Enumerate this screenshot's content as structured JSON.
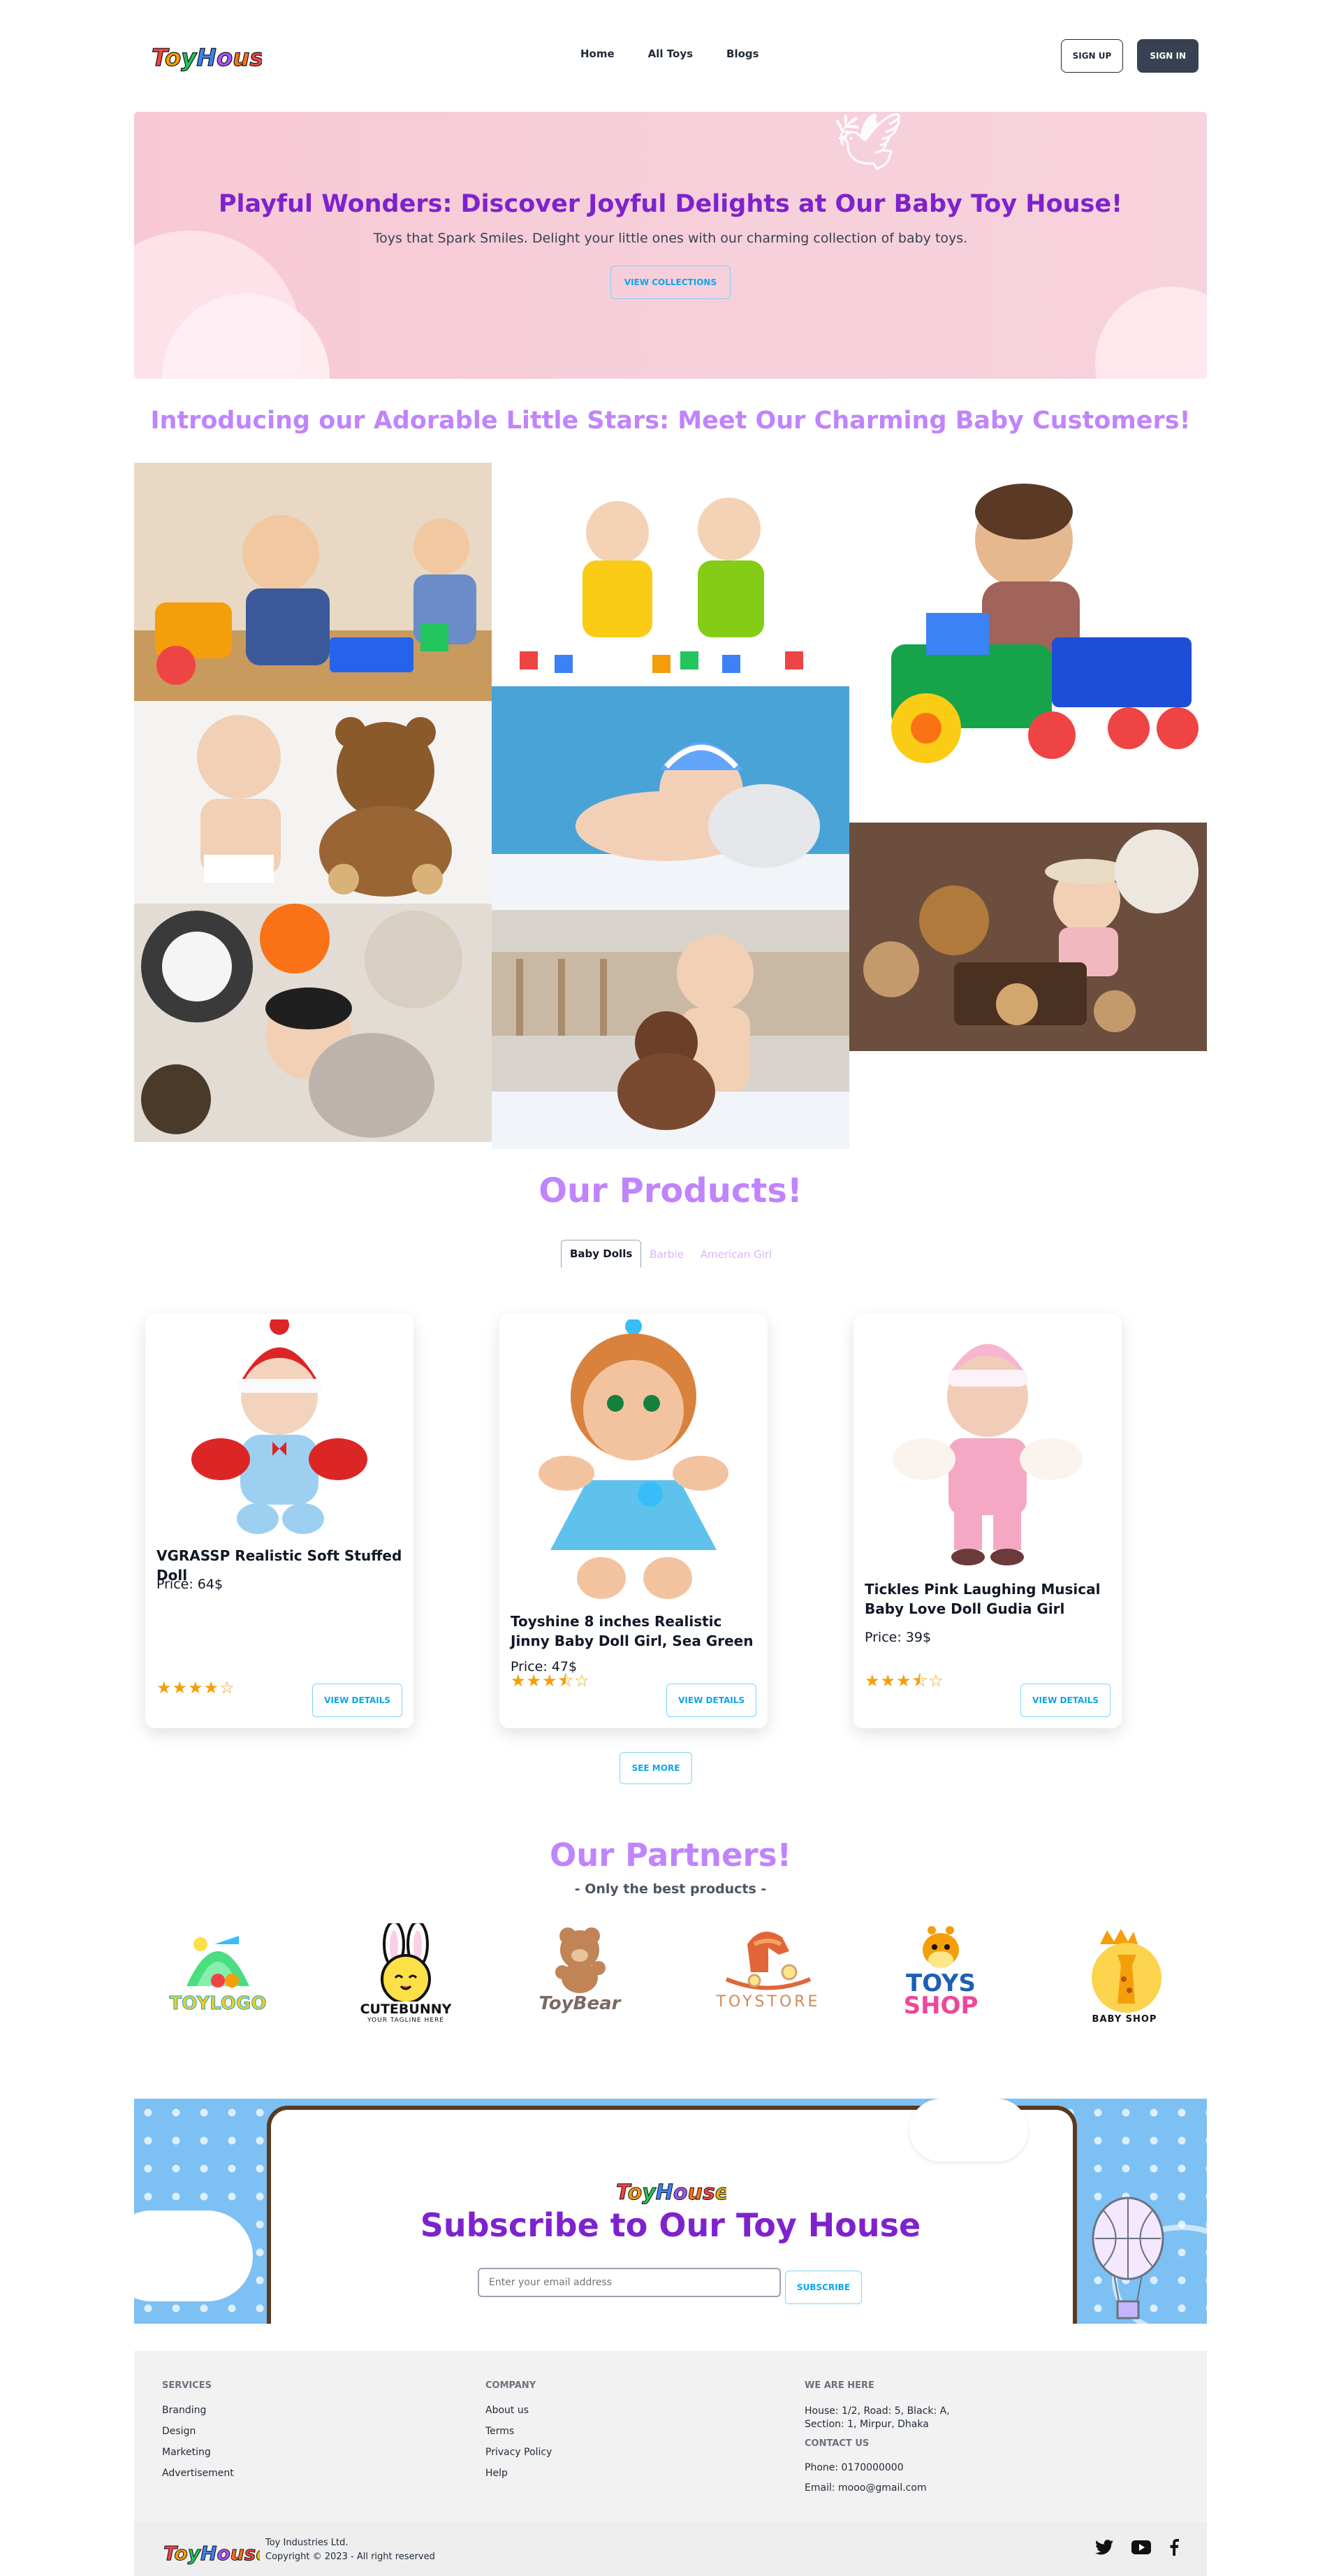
{
  "brand": {
    "logo_text": "ToyHouse"
  },
  "nav": {
    "links": [
      "Home",
      "All Toys",
      "Blogs"
    ],
    "signup": "SIGN UP",
    "signin": "SIGN IN"
  },
  "hero": {
    "title": "Playful Wonders: Discover Joyful Delights at Our Baby Toy House!",
    "subtitle": "Toys that Spark Smiles. Delight your little ones with our charming collection of baby toys.",
    "button": "VIEW COLLECTIONS"
  },
  "gallery": {
    "title": "Introducing our Adorable Little Stars: Meet Our Charming Baby Customers!"
  },
  "products": {
    "title": "Our Products!",
    "tabs": [
      "Baby Dolls",
      "Barbie",
      "American Girl"
    ],
    "items": [
      {
        "name": "VGRASSP Realistic Soft Stuffed Doll",
        "price": "Price: 64$",
        "rating": 4,
        "stars": "★★★★☆",
        "button": "VIEW DETAILS"
      },
      {
        "name": "Toyshine 8 inches Realistic Jinny Baby Doll Girl, Sea Green",
        "price": "Price: 47$",
        "rating": 3.5,
        "stars": "★★★⯪☆",
        "button": "VIEW DETAILS"
      },
      {
        "name": "Tickles Pink Laughing Musical Baby Love Doll Gudia Girl",
        "price": "Price: 39$",
        "rating": 3.5,
        "stars": "★★★⯪☆",
        "button": "VIEW DETAILS"
      }
    ],
    "see_more": "SEE MORE"
  },
  "partners": {
    "title": "Our Partners!",
    "subtitle": "- Only the best products -",
    "logos": [
      {
        "name": "TOYLOGO"
      },
      {
        "name": "CUTEBUNNY",
        "tagline": "YOUR TAGLINE HERE"
      },
      {
        "name": "ToyBear"
      },
      {
        "name": "TOYSTORE"
      },
      {
        "name_line1": "TOYS",
        "name_line2": "SHOP"
      },
      {
        "name": "BABY SHOP"
      }
    ]
  },
  "subscribe": {
    "title": "Subscribe to Our Toy House",
    "placeholder": "Enter your email address",
    "button": "SUBSCRIBE"
  },
  "footer": {
    "services": {
      "heading": "SERVICES",
      "links": [
        "Branding",
        "Design",
        "Marketing",
        "Advertisement"
      ]
    },
    "company": {
      "heading": "COMPANY",
      "links": [
        "About us",
        "Terms",
        "Privacy Policy",
        "Help"
      ]
    },
    "contact": {
      "heading": "WE ARE HERE",
      "address_line1": "House: 1/2, Road: 5, Black: A,",
      "address_line2": "Section: 1, Mirpur, Dhaka",
      "contact_heading": "CONTACT US",
      "phone": "Phone: 0170000000",
      "email": "Email: mooo@gmail.com"
    },
    "company_name": "Toy Industries Ltd.",
    "copyright": "Copyright © 2023 - All right reserved",
    "social": [
      "twitter-icon",
      "youtube-icon",
      "facebook-icon"
    ]
  },
  "colors": {
    "accent_purple": "#7e22ce",
    "light_purple": "#c084fc",
    "sky_blue": "#0ea5e9",
    "hero_pink": "#f8c9d4"
  }
}
